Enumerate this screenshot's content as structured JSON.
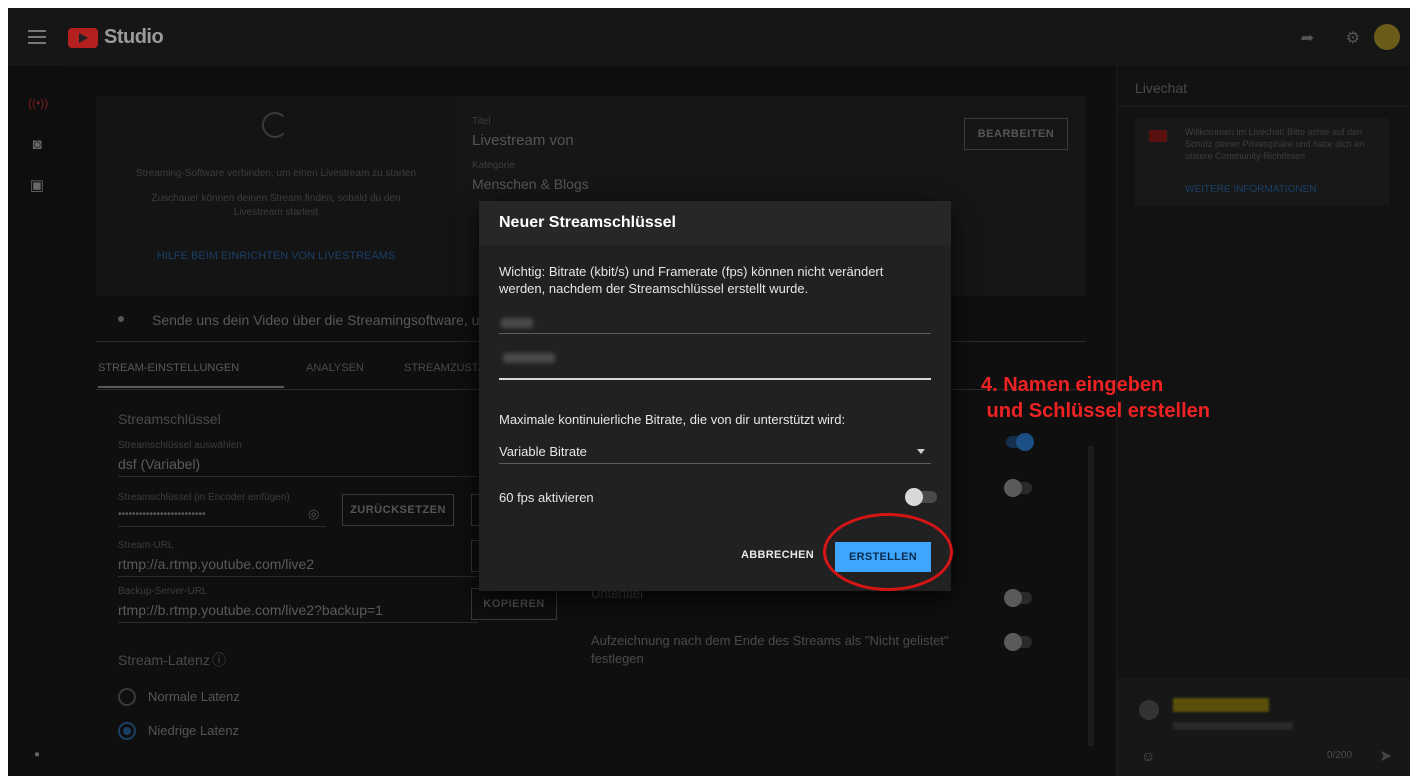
{
  "header": {
    "app_name": "Studio"
  },
  "main": {
    "status_text_1": "Streaming-Software verbinden, um einen Livestream zu starten",
    "status_text_2": "Zuschauer können deinen Stream finden, sobald du den Livestream startest",
    "help_link": "HILFE BEIM EINRICHTEN VON LIVESTREAMS",
    "title_label": "Titel",
    "title_value": "Livestream von",
    "category_label": "Kategorie",
    "category_value": "Menschen & Blogs",
    "edit_button": "BEARBEITEN",
    "send_hint": "Sende uns dein Video über die Streamingsoftware, um d",
    "tabs": [
      "STREAM-EINSTELLUNGEN",
      "ANALYSEN",
      "STREAMZUSTA"
    ],
    "stream_key_heading": "Streamschlüssel",
    "stream_key_select_label": "Streamschlüssel auswählen",
    "stream_key_select_value": "dsf (Variabel)",
    "stream_key_field_label": "Streamschlüssel (in Encoder einfügen)",
    "stream_key_masked": "•••••••••••••••••••••••••",
    "reset_button": "ZURÜCKSETZEN",
    "stream_url_label": "Stream-URL",
    "stream_url_value": "rtmp://a.rtmp.youtube.com/live2",
    "backup_url_label": "Backup-Server-URL",
    "backup_url_value": "rtmp://b.rtmp.youtube.com/live2?backup=1",
    "copy_button": "KOPIEREN",
    "latency_heading": "Stream-Latenz",
    "latency_options": [
      "Normale Latenz",
      "Niedrige Latenz"
    ],
    "subtitles_label": "Untertitel",
    "unlisted_label": "Aufzeichnung nach dem Ende des Streams als \"Nicht gelistet\" festlegen"
  },
  "chat": {
    "title": "Livechat",
    "welcome": "Willkommen im Livechat! Bitte achte auf den Schutz deiner Privatsphäre und halte dich an unsere Community-Richtlinien",
    "more_link": "WEITERE INFORMATIONEN",
    "counter": "0/200"
  },
  "dialog": {
    "title": "Neuer Streamschlüssel",
    "notice": "Wichtig: Bitrate (kbit/s) und Framerate (fps) können nicht verändert werden, nachdem der Streamschlüssel erstellt wurde.",
    "bitrate_label": "Maximale kontinuierliche Bitrate, die von dir unterstützt wird:",
    "bitrate_value": "Variable Bitrate",
    "fps_label": "60 fps aktivieren",
    "fps_enabled": false,
    "cancel_button": "ABBRECHEN",
    "create_button": "ERSTELLEN"
  },
  "annotation": {
    "text": "4. Namen eingeben\n und Schlüssel erstellen",
    "color": "#ee2222"
  }
}
